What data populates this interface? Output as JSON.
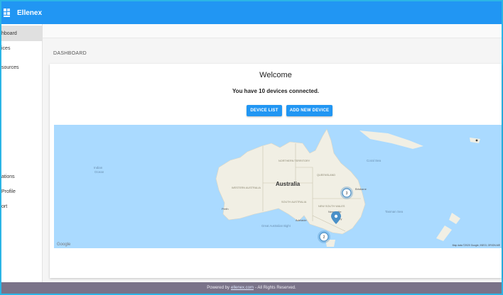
{
  "app": {
    "title": "Ellenex"
  },
  "sidebar": {
    "items": [
      {
        "label": "Dashboard",
        "visible": "hboard"
      },
      {
        "label": "Devices",
        "visible": "ices"
      },
      {
        "label": "Resources",
        "visible": "sources"
      },
      {
        "label": "Notifications",
        "visible": "ations"
      },
      {
        "label": "Profile",
        "visible": "Profile"
      },
      {
        "label": "Support",
        "visible": "ort"
      }
    ]
  },
  "main": {
    "breadcrumb": "DASHBOARD",
    "welcome": "Welcome",
    "devices_text": "You have 10 devices connected.",
    "buttons": {
      "device_list": "DEVICE LIST",
      "add_device": "ADD NEW DEVICE"
    }
  },
  "map": {
    "country_label": "Australia",
    "ocean_labels": {
      "indian": "Indian\nOcean",
      "southern": "Great Australian Bight",
      "coral": "Coral Sea",
      "tasman": "Tasman Sea"
    },
    "state_labels": {
      "nt": "NORTHERN TERRITORY",
      "wa": "WESTERN AUSTRALIA",
      "sa": "SOUTH AUSTRALIA",
      "qld": "QUEENSLAND",
      "nsw": "NEW SOUTH WALES",
      "vic": "VICTORIA"
    },
    "city_labels": {
      "perth": "Perth",
      "adelaide": "Adelaide",
      "melbourne": "Melbourne",
      "sydney": "Sydney",
      "newcastle": "Newcastle",
      "brisbane": "Brisbane"
    },
    "clusters": [
      {
        "count": "3"
      },
      {
        "count": "2"
      }
    ],
    "attribution": "Map data ©2020 Google, INEGI, ORION-ME",
    "google": "Google"
  },
  "footer": {
    "prefix": "Powered by",
    "link": "ellenex.com",
    "suffix": "- All Rights Reserved."
  },
  "colors": {
    "brand": "#2196f3",
    "ocean": "#aadaff",
    "land": "#f1efe4",
    "footer": "#7a7389"
  }
}
